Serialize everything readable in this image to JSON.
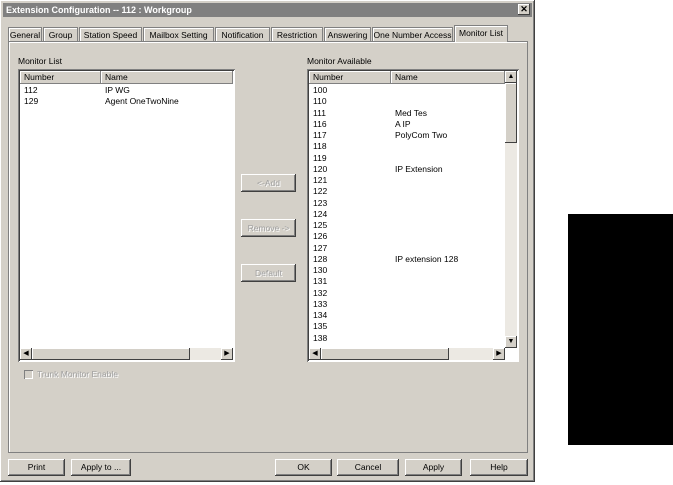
{
  "window": {
    "title": "Extension Configuration -- 112 : Workgroup",
    "close_glyph": "✕"
  },
  "tabs": [
    {
      "label": "General"
    },
    {
      "label": "Group"
    },
    {
      "label": "Station Speed"
    },
    {
      "label": "Mailbox Setting"
    },
    {
      "label": "Notification"
    },
    {
      "label": "Restriction"
    },
    {
      "label": "Answering"
    },
    {
      "label": "One Number Access"
    },
    {
      "label": "Monitor List"
    }
  ],
  "active_tab": "Monitor List",
  "monitor_list": {
    "label": "Monitor List",
    "columns": [
      "Number",
      "Name"
    ],
    "rows": [
      {
        "number": "112",
        "name": "IP WG"
      },
      {
        "number": "129",
        "name": "Agent OneTwoNine"
      }
    ]
  },
  "monitor_available": {
    "label": "Monitor Available",
    "columns": [
      "Number",
      "Name"
    ],
    "rows": [
      {
        "number": "100",
        "name": ""
      },
      {
        "number": "110",
        "name": ""
      },
      {
        "number": "111",
        "name": "Med Tes"
      },
      {
        "number": "116",
        "name": "A IP"
      },
      {
        "number": "117",
        "name": "PolyCom Two"
      },
      {
        "number": "118",
        "name": ""
      },
      {
        "number": "119",
        "name": ""
      },
      {
        "number": "120",
        "name": "IP Extension"
      },
      {
        "number": "121",
        "name": ""
      },
      {
        "number": "122",
        "name": ""
      },
      {
        "number": "123",
        "name": ""
      },
      {
        "number": "124",
        "name": ""
      },
      {
        "number": "125",
        "name": ""
      },
      {
        "number": "126",
        "name": ""
      },
      {
        "number": "127",
        "name": ""
      },
      {
        "number": "128",
        "name": "IP extension 128"
      },
      {
        "number": "130",
        "name": ""
      },
      {
        "number": "131",
        "name": ""
      },
      {
        "number": "132",
        "name": ""
      },
      {
        "number": "133",
        "name": ""
      },
      {
        "number": "134",
        "name": ""
      },
      {
        "number": "135",
        "name": ""
      },
      {
        "number": "138",
        "name": ""
      }
    ]
  },
  "middle_buttons": {
    "add": "<-Add",
    "remove": "Remove ->",
    "default": "Default"
  },
  "trunk_monitor": {
    "label": "Trunk Monitor Enable",
    "checked": false
  },
  "bottom_buttons": {
    "print": "Print",
    "apply_to": "Apply to ...",
    "ok": "OK",
    "cancel": "Cancel",
    "apply": "Apply",
    "help": "Help"
  },
  "scroll_glyphs": {
    "left": "◀",
    "right": "▶",
    "up": "▲",
    "down": "▼"
  }
}
